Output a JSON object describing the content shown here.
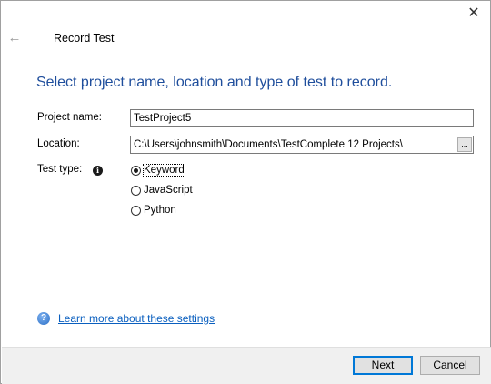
{
  "window": {
    "close_glyph": "✕",
    "back_glyph": "←",
    "title": "Record Test"
  },
  "heading": "Select project name, location and type of test to record.",
  "form": {
    "project_name_label": "Project name:",
    "project_name_value": "TestProject5",
    "location_label": "Location:",
    "location_value": "C:\\Users\\johnsmith\\Documents\\TestComplete 12 Projects\\",
    "browse_label": "...",
    "test_type_label": "Test type:",
    "info_glyph": "i",
    "test_types": [
      {
        "label": "Keyword",
        "selected": true
      },
      {
        "label": "JavaScript",
        "selected": false
      },
      {
        "label": "Python",
        "selected": false
      }
    ]
  },
  "help": {
    "icon_glyph": "?",
    "link_text": "Learn more about these settings"
  },
  "buttons": {
    "next": "Next",
    "cancel": "Cancel"
  },
  "colors": {
    "heading": "#1f4e9c",
    "link": "#0a5fbf",
    "default_button_border": "#0078d7",
    "footer_bg": "#f0f0f0"
  }
}
